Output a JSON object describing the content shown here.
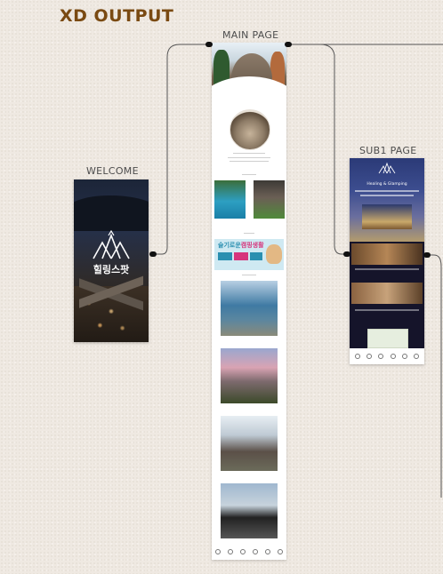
{
  "header": {
    "title": "XD OUTPUT"
  },
  "artboards": {
    "welcome": {
      "label": "WELCOME",
      "app_title": "힐링스팟"
    },
    "main": {
      "label": "MAIN PAGE",
      "banner_text_a": "슬기로운",
      "banner_text_b": "캠핑생활"
    },
    "sub1": {
      "label": "SUB1 PAGE",
      "title": "Healing & Glamping"
    }
  },
  "colors": {
    "heading": "#7a4a12",
    "connector": "#555555",
    "background": "#efe9e2"
  }
}
